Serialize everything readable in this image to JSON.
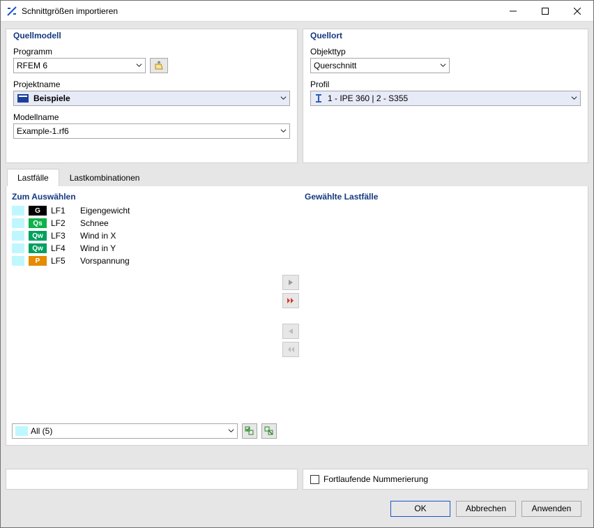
{
  "window": {
    "title": "Schnittgrößen importieren"
  },
  "source_model": {
    "title": "Quellmodell",
    "program_label": "Programm",
    "program_value": "RFEM 6",
    "project_label": "Projektname",
    "project_value": "Beispiele",
    "model_label": "Modellname",
    "model_value": "Example-1.rf6"
  },
  "source_loc": {
    "title": "Quellort",
    "objtype_label": "Objekttyp",
    "objtype_value": "Querschnitt",
    "profile_label": "Profil",
    "profile_value": "1 - IPE 360 | 2 - S355"
  },
  "tabs": {
    "loadcases": "Lastfälle",
    "combos": "Lastkombinationen"
  },
  "available": {
    "title": "Zum Auswählen",
    "filter": "All (5)",
    "items": [
      {
        "badge": "G",
        "badgeClass": "b-G",
        "id": "LF1",
        "name": "Eigengewicht"
      },
      {
        "badge": "Qs",
        "badgeClass": "b-Qs",
        "id": "LF2",
        "name": "Schnee"
      },
      {
        "badge": "Qw",
        "badgeClass": "b-Qw",
        "id": "LF3",
        "name": "Wind in X"
      },
      {
        "badge": "Qw",
        "badgeClass": "b-Qw",
        "id": "LF4",
        "name": "Wind in Y"
      },
      {
        "badge": "P",
        "badgeClass": "b-P",
        "id": "LF5",
        "name": "Vorspannung"
      }
    ]
  },
  "selected": {
    "title": "Gewählte Lastfälle"
  },
  "options": {
    "continuous_numbering": "Fortlaufende Nummerierung"
  },
  "buttons": {
    "ok": "OK",
    "cancel": "Abbrechen",
    "apply": "Anwenden"
  }
}
